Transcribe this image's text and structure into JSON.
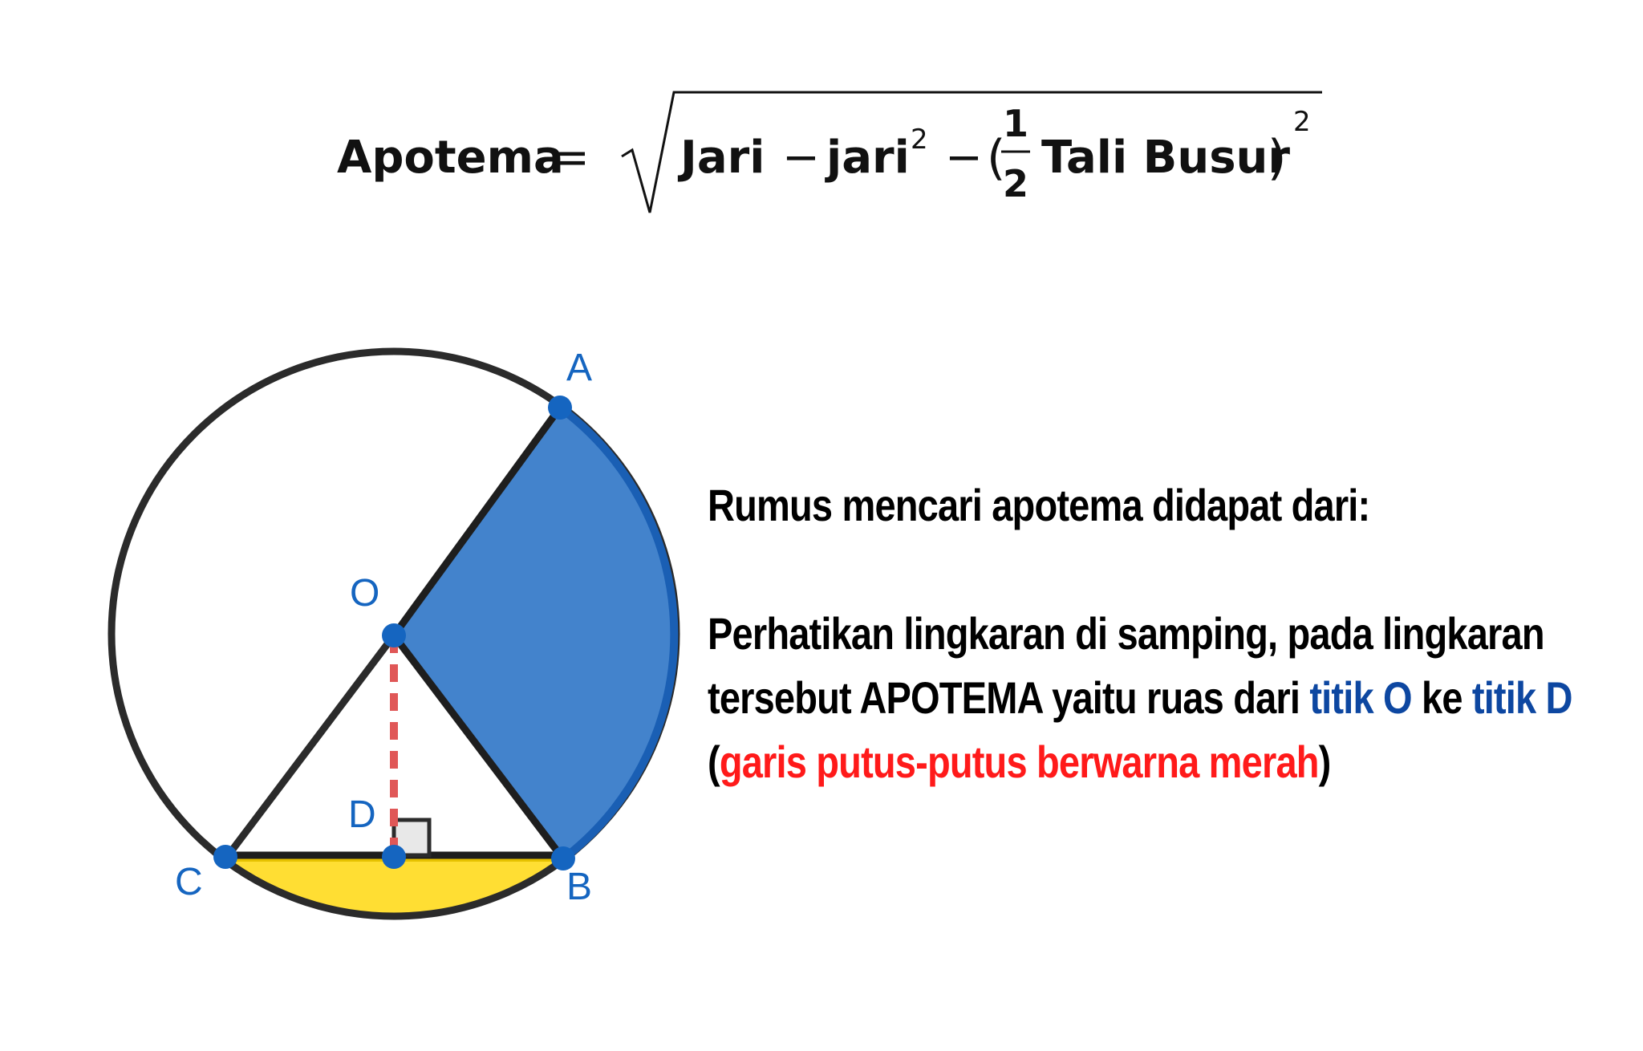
{
  "formula": {
    "lhs": "Apotema",
    "equals": "=",
    "term1": "Jari",
    "minus1": "−",
    "term2": "jari",
    "exp1": "2",
    "minus2": "−",
    "open_paren": "(",
    "frac_num": "1",
    "frac_den": "2",
    "term3": "Tali Busur",
    "close_paren": ")",
    "exp2": "2"
  },
  "points": {
    "A": "A",
    "O": "O",
    "D": "D",
    "C": "C",
    "B": "B"
  },
  "colors": {
    "sector_fill": "#4383cc",
    "arc_blue": "#1a5fb4",
    "segment_fill": "#ffde33",
    "point": "#1565c0",
    "apothem": "#e05757",
    "outline": "#2b2b2b"
  },
  "explanation": {
    "heading": "Rumus mencari apotema didapat dari:",
    "line1": "Perhatikan lingkaran di samping, pada lingkaran",
    "line2_a": "tersebut APOTEMA yaitu ruas dari ",
    "line2_b": "titik O",
    "line2_c": " ke ",
    "line2_d": "titik D",
    "line3_a": "(",
    "line3_b": "garis putus-putus berwarna merah",
    "line3_c": ")"
  }
}
